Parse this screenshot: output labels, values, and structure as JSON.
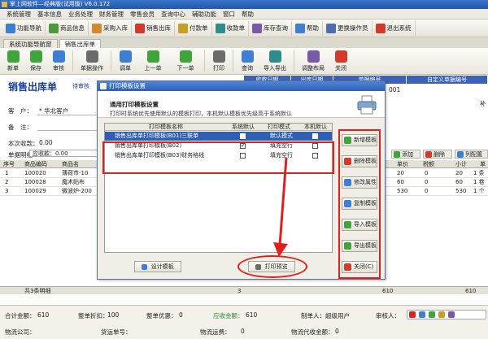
{
  "app": {
    "title": "掌上网软件—经典版(试用版)  V6.0.172"
  },
  "menu": [
    "系统管理",
    "基本信息",
    "业务处理",
    "财务管理",
    "零售会员",
    "查询中心",
    "辅助功能",
    "窗口",
    "帮助"
  ],
  "toolbar1": [
    {
      "label": "功能导航",
      "icon": "compass-icon",
      "color": "#3d7fd4"
    },
    {
      "label": "商品信息",
      "icon": "box-icon",
      "color": "#4b9a3a"
    },
    {
      "label": "采购入库",
      "icon": "truck-icon",
      "color": "#d48a2a"
    },
    {
      "label": "销售出库",
      "icon": "cart-icon",
      "color": "#d43a2a"
    },
    {
      "label": "付款单",
      "icon": "pay-icon",
      "color": "#c7a021"
    },
    {
      "label": "收款单",
      "icon": "receive-icon",
      "color": "#2f8c8c"
    },
    {
      "label": "库存查询",
      "icon": "warehouse-icon",
      "color": "#7a5aa8"
    },
    {
      "label": "帮助",
      "icon": "help-icon",
      "color": "#3d7fd4"
    },
    {
      "label": "更换操作员",
      "icon": "user-icon",
      "color": "#4a6fb0"
    },
    {
      "label": "退出系统",
      "icon": "exit-icon",
      "color": "#d43a2a"
    }
  ],
  "tabs": [
    {
      "label": "系统功能导航窗"
    },
    {
      "label": "销售出库单"
    }
  ],
  "toolbar2": [
    {
      "label": "新单",
      "icon": "new-icon",
      "color": "#3fa43a"
    },
    {
      "label": "保存",
      "icon": "save-icon",
      "color": "#3fa43a"
    },
    {
      "label": "审核",
      "icon": "audit-icon",
      "color": "#3d7fd4"
    },
    {
      "label": "单据操作",
      "icon": "doc-icon",
      "color": "#6b6b6b"
    },
    {
      "label": "调单",
      "icon": "load-icon",
      "color": "#3d7fd4"
    },
    {
      "label": "上一单",
      "icon": "prev-icon",
      "color": "#3fa43a"
    },
    {
      "label": "下一单",
      "icon": "next-icon",
      "color": "#3fa43a"
    },
    {
      "label": "打印",
      "icon": "print-icon",
      "color": "#6b6b6b"
    },
    {
      "label": "查询",
      "icon": "query-icon",
      "color": "#3d7fd4"
    },
    {
      "label": "导入导出",
      "icon": "io-icon",
      "color": "#2f8c8c"
    },
    {
      "label": "调整布局",
      "icon": "layout-icon",
      "color": "#7a5aa8"
    },
    {
      "label": "关闭",
      "icon": "close-icon",
      "color": "#d43a2a"
    }
  ],
  "form": {
    "heading": "销售出库单",
    "status": "待审核",
    "hdr_cols": [
      "收款日期",
      "出库日期",
      "单据编号",
      "自定义单据编号"
    ],
    "doc_no": "001",
    "client_label": "客　户：",
    "client_value": "* 华北客户",
    "remark_label": "备　注：",
    "collect_label": "本次收款：",
    "collect_value": "0.00",
    "detail_label": "单据明细：",
    "detail_value": "应收款：0.00",
    "btn_add": "添加",
    "btn_delete": "删除",
    "btn_config": "列配置",
    "right_edge": "补"
  },
  "table": {
    "headers": [
      "序号",
      "商品编码",
      "商品名",
      "",
      "单价",
      "税额",
      "小计",
      "单"
    ],
    "rows": [
      {
        "idx": "1",
        "code": "100020",
        "name": "薄荷市-10",
        "price": "20",
        "tax": "0",
        "sub": "20",
        "unit": "1 条"
      },
      {
        "idx": "2",
        "code": "100028",
        "name": "魔术贴布",
        "price": "60",
        "tax": "0",
        "sub": "60",
        "unit": "1 卷"
      },
      {
        "idx": "3",
        "code": "100029",
        "name": "微波炉-200",
        "price": "530",
        "tax": "0",
        "sub": "530",
        "unit": "1 个"
      }
    ],
    "footer_count": "共3条明细",
    "footer_qty": "3",
    "footer_amt": "610",
    "footer_end": "610"
  },
  "bottom": {
    "total_label": "合计金额：",
    "total_value": "610",
    "discount_label": "整单折扣：",
    "discount_value": "100",
    "favour_label": "整单优惠：",
    "favour_value": "0",
    "receivable_label": "应收金额：",
    "receivable_value": "610",
    "maker_label": "制单人：",
    "maker_value": "超级用户",
    "auditor_label": "审核人：",
    "logistics_label": "物流公司：",
    "transport_label": "货运单号：",
    "freight_label": "物流运费：",
    "freight_value": "0",
    "cod_label": "物流代收金额：",
    "cod_value": "0"
  },
  "dialog": {
    "title": "打印模板设置",
    "heading": "通用打印模板设置",
    "desc": "打印时系统优先使用默认的模板打印，本机默认模板优先级高于系统默认",
    "col_headers": [
      "打印模板名称",
      "系统默认",
      "打印模式",
      "本机默认"
    ],
    "rows": [
      {
        "name": "销售出库单打印模板(B01)三联单",
        "sys": "■",
        "mode": "默认模式",
        "local": "□",
        "selected": true
      },
      {
        "name": "销售出库单打印模板(B02)",
        "sys": "✓",
        "mode": "填充空行",
        "local": "□",
        "selected": false
      },
      {
        "name": "销售出库单打印模板(B03)财务格线",
        "sys": "□",
        "mode": "填充空行",
        "local": "□",
        "selected": false
      }
    ],
    "side_buttons": [
      {
        "label": "新增模板",
        "icon": "add-template-icon",
        "color": "#3fa43a"
      },
      {
        "label": "删除模板",
        "icon": "delete-template-icon",
        "color": "#d43a2a"
      },
      {
        "label": "修改属性",
        "icon": "edit-props-icon",
        "color": "#3d7fd4"
      },
      {
        "label": "复制模板",
        "icon": "copy-template-icon",
        "color": "#3d7fd4"
      },
      {
        "label": "导入模板",
        "icon": "import-template-icon",
        "color": "#3fa43a"
      },
      {
        "label": "导出模板",
        "icon": "export-template-icon",
        "color": "#3fa43a"
      },
      {
        "label": "关闭(C)",
        "icon": "close-icon",
        "color": "#d43a2a"
      }
    ],
    "design_label": "设计模板",
    "preview_label": "打印预览"
  }
}
